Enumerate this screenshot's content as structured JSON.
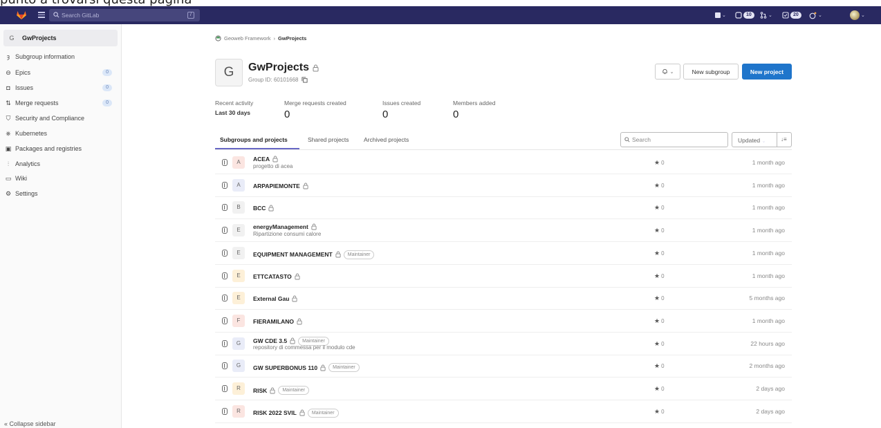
{
  "caption": "punto a trovarsi questa pagina",
  "navbar": {
    "search_placeholder": "Search GitLab",
    "search_kbd": "/",
    "mr_count": "10",
    "todo_count": "20",
    "colors": {
      "bg": "#292961",
      "search_bg": "#46467c"
    }
  },
  "sidebar": {
    "group_letter": "G",
    "group_name": "GwProjects",
    "items": [
      {
        "label": "Subgroup information",
        "icon": "subgroup-icon"
      },
      {
        "label": "Epics",
        "icon": "epic-icon",
        "count": "0"
      },
      {
        "label": "Issues",
        "icon": "issues-icon",
        "count": "0"
      },
      {
        "label": "Merge requests",
        "icon": "merge-request-icon",
        "count": "0"
      },
      {
        "label": "Security and Compliance",
        "icon": "shield-icon"
      },
      {
        "label": "Kubernetes",
        "icon": "kubernetes-icon"
      },
      {
        "label": "Packages and registries",
        "icon": "package-icon"
      },
      {
        "label": "Analytics",
        "icon": "analytics-icon"
      },
      {
        "label": "Wiki",
        "icon": "wiki-icon"
      },
      {
        "label": "Settings",
        "icon": "settings-icon"
      }
    ],
    "collapse_label": "Collapse sidebar"
  },
  "breadcrumb": {
    "parent": "Geoweb Framework",
    "current": "GwProjects"
  },
  "group": {
    "letter": "G",
    "title": "GwProjects",
    "id_text": "Group ID: 60101668"
  },
  "buttons": {
    "notifications": "",
    "new_subgroup": "New subgroup",
    "new_project": "New project"
  },
  "stats": {
    "recent_label": "Recent activity",
    "period": "Last 30 days",
    "mr_label": "Merge requests created",
    "mr_value": "0",
    "issues_label": "Issues created",
    "issues_value": "0",
    "members_label": "Members added",
    "members_value": "0"
  },
  "tabs": [
    "Subgroups and projects",
    "Shared projects",
    "Archived projects"
  ],
  "filter": {
    "search_placeholder": "Search",
    "sort_label": "Updated"
  },
  "projects": [
    {
      "letter": "A",
      "name": "ACEA",
      "desc": "progetto di acea",
      "role": "",
      "stars": "0",
      "updated": "1 month ago",
      "color": "#fbe5e1"
    },
    {
      "letter": "A",
      "name": "ARPAPIEMONTE",
      "desc": "",
      "role": "",
      "stars": "0",
      "updated": "1 month ago",
      "color": "#e9ecf8"
    },
    {
      "letter": "B",
      "name": "BCC",
      "desc": "",
      "role": "",
      "stars": "0",
      "updated": "1 month ago",
      "color": "#f1f1f1"
    },
    {
      "letter": "E",
      "name": "energyManagement",
      "desc": "Ripartizione consumi calore",
      "role": "",
      "stars": "0",
      "updated": "1 month ago",
      "color": "#f1f1f1"
    },
    {
      "letter": "E",
      "name": "EQUIPMENT MANAGEMENT",
      "desc": "",
      "role": "Maintainer",
      "stars": "0",
      "updated": "1 month ago",
      "color": "#f1f1f1"
    },
    {
      "letter": "E",
      "name": "ETTCATASTO",
      "desc": "",
      "role": "",
      "stars": "0",
      "updated": "1 month ago",
      "color": "#fdf0d8"
    },
    {
      "letter": "E",
      "name": "External Gau",
      "desc": "",
      "role": "",
      "stars": "0",
      "updated": "5 months ago",
      "color": "#fdf0d8"
    },
    {
      "letter": "F",
      "name": "FIERAMILANO",
      "desc": "",
      "role": "",
      "stars": "0",
      "updated": "1 month ago",
      "color": "#fbe5e1"
    },
    {
      "letter": "G",
      "name": "GW CDE 3.5",
      "desc": "repository di commessa per il modulo cde",
      "role": "Maintainer",
      "stars": "0",
      "updated": "22 hours ago",
      "color": "#e9ecf8"
    },
    {
      "letter": "G",
      "name": "GW SUPERBONUS 110",
      "desc": "",
      "role": "Maintainer",
      "stars": "0",
      "updated": "2 months ago",
      "color": "#e9ecf8"
    },
    {
      "letter": "R",
      "name": "RISK",
      "desc": "",
      "role": "Maintainer",
      "stars": "0",
      "updated": "2 days ago",
      "color": "#fdf0d8"
    },
    {
      "letter": "R",
      "name": "RISK 2022 SVIL",
      "desc": "",
      "role": "Maintainer",
      "stars": "0",
      "updated": "2 days ago",
      "color": "#fbe5e1"
    }
  ]
}
